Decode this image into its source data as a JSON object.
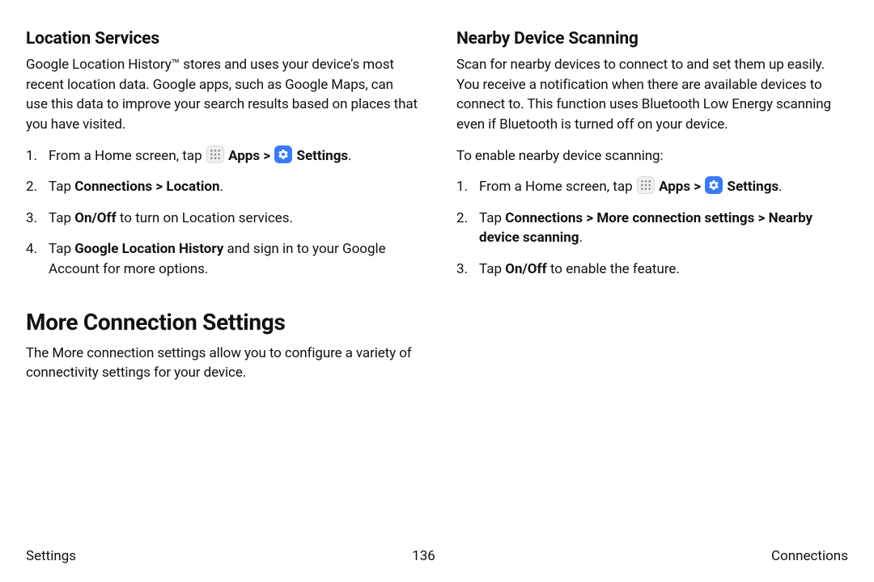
{
  "left": {
    "h_location": "Location Services",
    "p_location": "Google Location History™ stores and uses your device's most recent location data. Google apps, such as Google Maps, can use this data to improve your search results based on places that you have visited.",
    "step1_pre": "From a Home screen, tap ",
    "apps_label": "Apps",
    "apps_chev": " > ",
    "settings_label": "Settings",
    "step1_post": ".",
    "step2_pre": "Tap ",
    "step2_bold": "Connections > Location",
    "step2_post": ".",
    "step3_pre": "Tap ",
    "step3_bold": "On/Off",
    "step3_post": " to turn on Location services.",
    "step4_pre": "Tap ",
    "step4_bold": "Google Location History",
    "step4_post": " and sign in to your Google Account for more options.",
    "h_more": "More Connection Settings",
    "p_more": "The More connection settings allow you to configure a variety of connectivity settings for your device."
  },
  "right": {
    "h_nearby": "Nearby Device Scanning",
    "p_nearby": "Scan for nearby devices to connect to and set them up easily. You receive a notification when there are available devices to connect to. This function uses Bluetooth Low Energy scanning even if Bluetooth is turned off on your device.",
    "p_enable": "To enable nearby device scanning:",
    "step1_pre": "From a Home screen, tap ",
    "apps_label": "Apps",
    "apps_chev": " > ",
    "settings_label": "Settings",
    "step1_post": ".",
    "step2_pre": "Tap ",
    "step2_bold": "Connections > More connection settings > Nearby device scanning",
    "step2_post": ".",
    "step3_pre": "Tap ",
    "step3_bold": "On/Off",
    "step3_post": " to enable the feature."
  },
  "footer": {
    "left": "Settings",
    "center": "136",
    "right": "Connections"
  }
}
